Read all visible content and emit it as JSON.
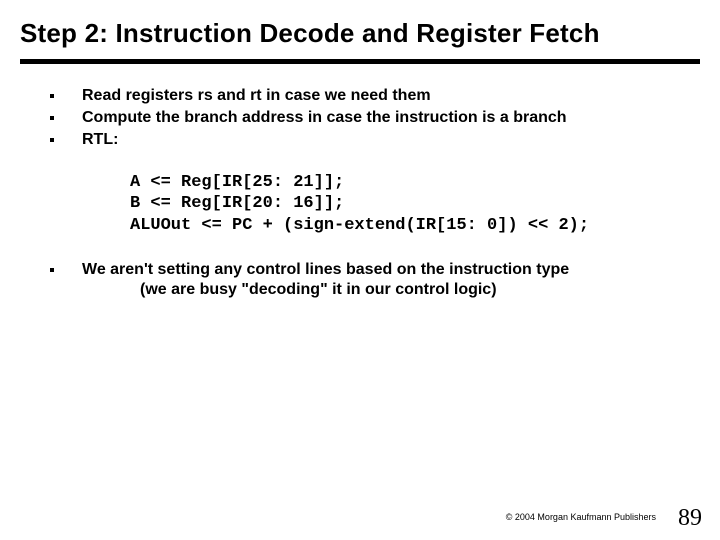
{
  "title": "Step 2:  Instruction Decode and Register Fetch",
  "bullets_top": [
    "Read registers rs and rt in case we need them",
    "Compute the branch address in case the instruction is a branch",
    "RTL:"
  ],
  "code": "A <= Reg[IR[25: 21]];\nB <= Reg[IR[20: 16]];\nALUOut <= PC + (sign-extend(IR[15: 0]) << 2);",
  "bullet_bottom_line1": "We aren't setting any control lines based on the instruction type",
  "bullet_bottom_line2": "(we are busy \"decoding\" it in our control logic)",
  "copyright": "© 2004 Morgan Kaufmann Publishers",
  "page_number": "89"
}
